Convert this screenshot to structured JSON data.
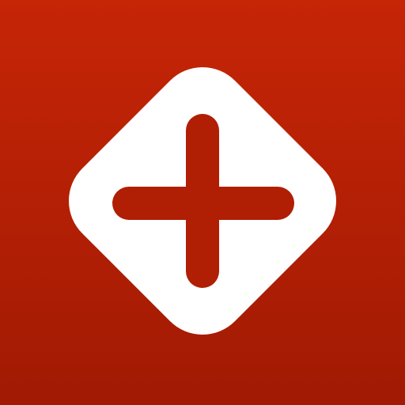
{
  "icon": {
    "name": "medical-plus-icon",
    "colors": {
      "background_top": "#C62506",
      "background_bottom": "#A11A04",
      "diamond": "#FFFFFF",
      "cross": "#B01E04"
    }
  }
}
